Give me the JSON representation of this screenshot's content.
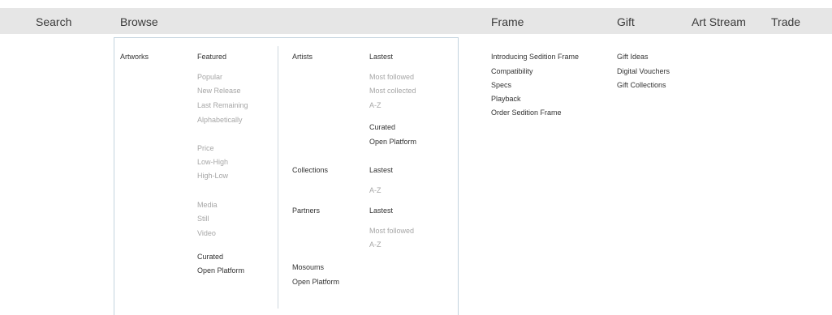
{
  "nav": {
    "search": "Search",
    "browse": "Browse",
    "frame": "Frame",
    "gift": "Gift",
    "art_stream": "Art Stream",
    "trade": "Trade"
  },
  "browse_menu": {
    "artworks": {
      "label": "Artworks",
      "featured": "Featured",
      "featured_items": [
        "Popular",
        "New Release",
        "Last Remaining",
        "Alphabetically"
      ],
      "price": "Price",
      "price_items": [
        "Low-High",
        "High-Low"
      ],
      "media": "Media",
      "media_items": [
        "Still",
        "Video"
      ],
      "curated": "Curated",
      "open_platform": "Open Platform"
    },
    "artists": {
      "label": "Artists",
      "lastest": "Lastest",
      "items": [
        "Most followed",
        "Most collected",
        "A-Z"
      ],
      "curated": "Curated",
      "open_platform": "Open Platform"
    },
    "collections": {
      "label": "Collections",
      "lastest": "Lastest",
      "az": "A-Z"
    },
    "partners": {
      "label": "Partners",
      "lastest": "Lastest",
      "items": [
        "Most followed",
        "A-Z"
      ]
    },
    "museums": {
      "label": "Mosoums",
      "open_platform": "Open Platform"
    }
  },
  "frame_menu": {
    "items": [
      "Introducing Sedition Frame",
      "Compatibility",
      "Specs",
      "Playback",
      "Order Sedition Frame"
    ]
  },
  "gift_menu": {
    "items": [
      "Gift Ideas",
      "Digital Vouchers",
      "Gift Collections"
    ]
  }
}
